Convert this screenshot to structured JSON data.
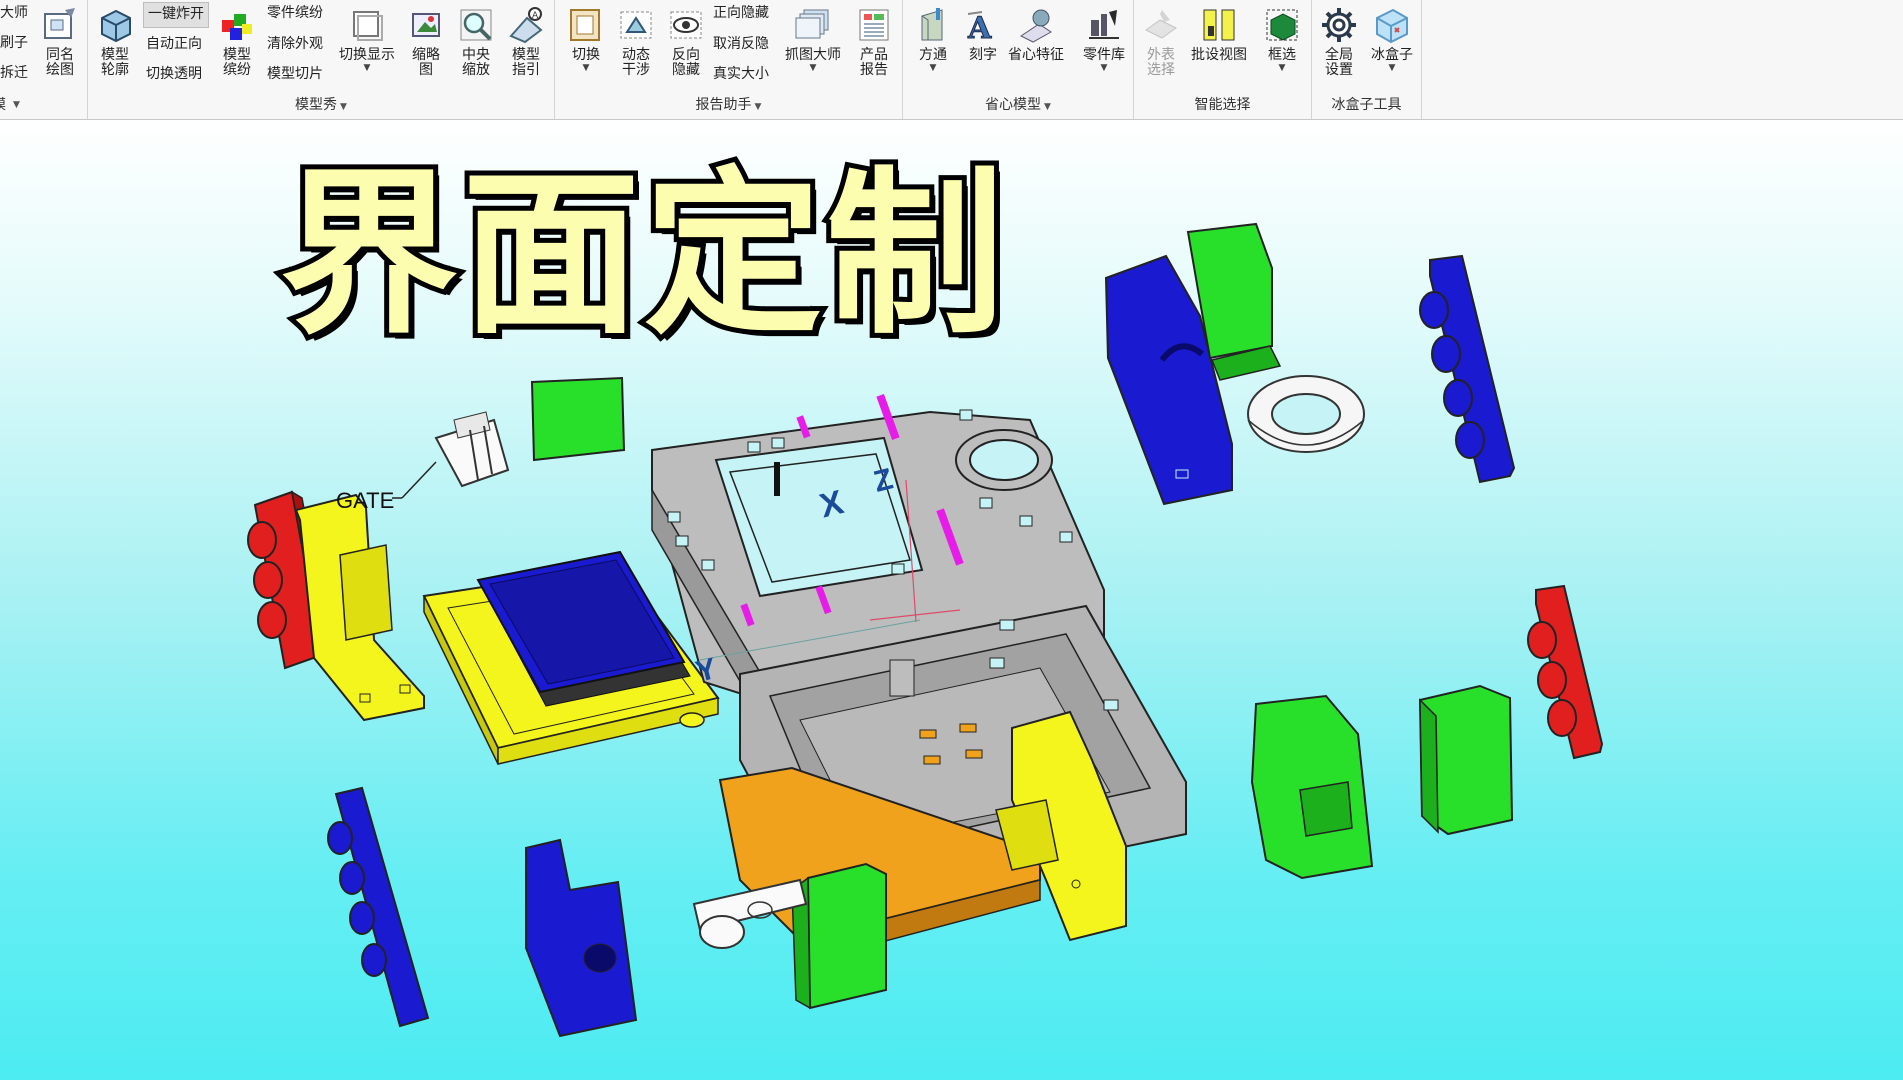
{
  "ribbon": {
    "groups": [
      {
        "name": "partial-left",
        "label": "模",
        "small_buttons": [
          "大师",
          "刷子",
          "拆迁"
        ],
        "big_buttons": [
          {
            "label": "同名绘图",
            "icon": "drawing-icon"
          }
        ]
      },
      {
        "name": "model-show",
        "label": "模型秀",
        "big_buttons": [
          {
            "label": "模型轮廓",
            "icon": "model-outline-icon"
          },
          {
            "label": "模型缤纷",
            "icon": "model-color-icon"
          },
          {
            "label": "切换显示",
            "icon": "toggle-display-icon"
          },
          {
            "label": "缩略图",
            "icon": "thumbnail-icon"
          },
          {
            "label": "中央缩放",
            "icon": "center-zoom-icon"
          },
          {
            "label": "模型指引",
            "icon": "model-guide-icon"
          }
        ],
        "small_buttons": [
          "一键炸开",
          "自动正向",
          "切换透明",
          "零件缤纷",
          "清除外观",
          "模型切片"
        ]
      },
      {
        "name": "report-helper",
        "label": "报告助手",
        "big_buttons": [
          {
            "label": "切换",
            "icon": "switch-icon"
          },
          {
            "label": "动态干涉",
            "icon": "dynamic-interference-icon"
          },
          {
            "label": "反向隐藏",
            "icon": "reverse-hide-icon"
          },
          {
            "label": "抓图大师",
            "icon": "screenshot-master-icon"
          },
          {
            "label": "产品报告",
            "icon": "product-report-icon"
          }
        ],
        "small_buttons": [
          "正向隐藏",
          "取消反隐",
          "真实大小"
        ]
      },
      {
        "name": "save-model",
        "label": "省心模型",
        "big_buttons": [
          {
            "label": "方通",
            "icon": "square-tube-icon"
          },
          {
            "label": "刻字",
            "icon": "engrave-text-icon"
          },
          {
            "label": "省心特征",
            "icon": "feature-icon"
          },
          {
            "label": "零件库",
            "icon": "part-library-icon"
          }
        ]
      },
      {
        "name": "smart-select",
        "label": "智能选择",
        "big_buttons": [
          {
            "label": "外表选择",
            "icon": "appearance-select-icon"
          },
          {
            "label": "批设视图",
            "icon": "batch-view-icon"
          },
          {
            "label": "框选",
            "icon": "box-select-icon"
          }
        ]
      },
      {
        "name": "icebox-tools",
        "label": "冰盒子工具",
        "big_buttons": [
          {
            "label": "全局设置",
            "icon": "gear-icon"
          },
          {
            "label": "冰盒子",
            "icon": "ice-cube-icon"
          }
        ]
      }
    ]
  },
  "viewport": {
    "title_overlay": "界面定制",
    "annotation_gate": "GATE",
    "axis_x": "X",
    "axis_z": "Z",
    "axis_y": "Y",
    "colors": {
      "red": "#e21f1f",
      "yellow": "#f2f21a",
      "green": "#28e02a",
      "blue": "#1a1ad0",
      "gray": "#b9b9b9",
      "orange": "#f0a21c",
      "magenta": "#e81ce8"
    }
  }
}
